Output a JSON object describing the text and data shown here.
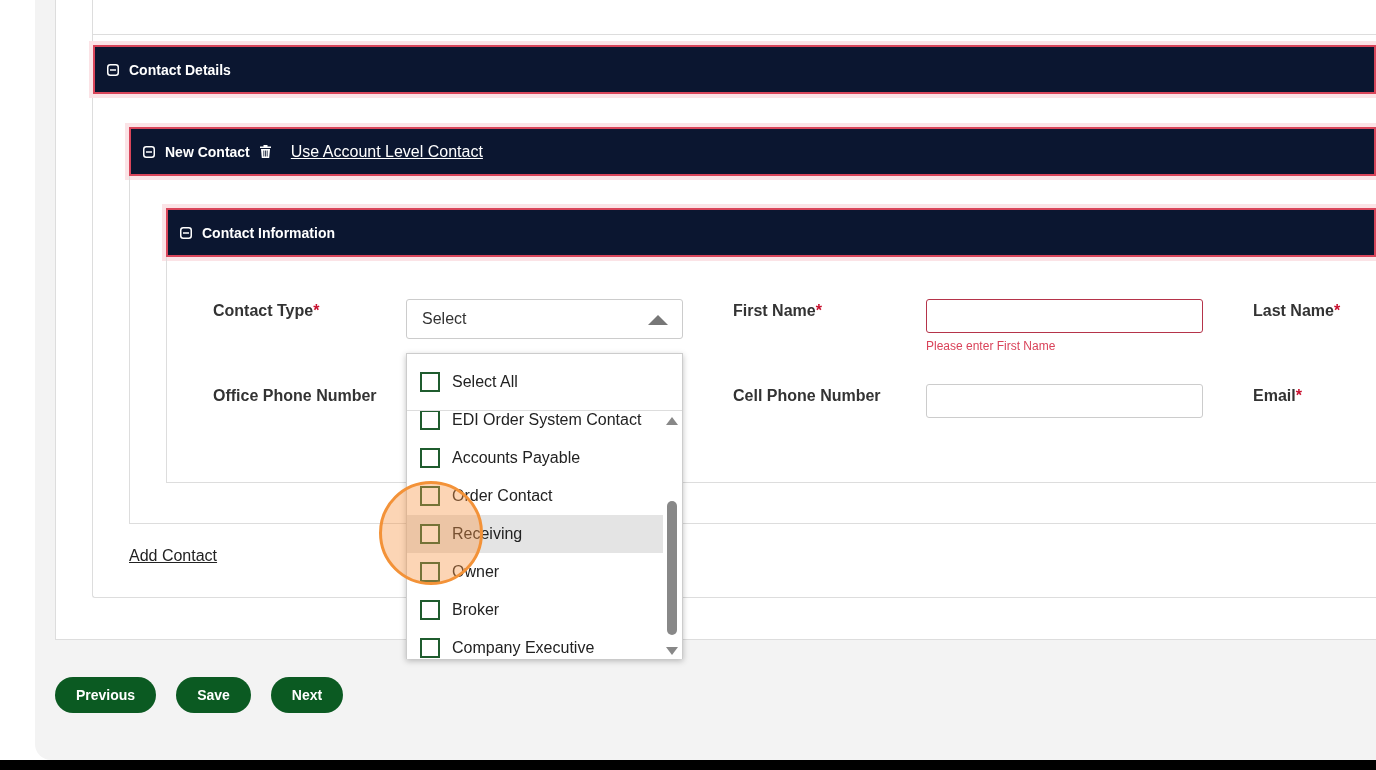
{
  "sections": {
    "contact_details": {
      "title": "Contact Details",
      "expanded": true
    },
    "new_contact": {
      "title": "New Contact",
      "link": "Use Account Level Contact",
      "expanded": true
    },
    "contact_information": {
      "title": "Contact Information",
      "expanded": true
    }
  },
  "fields": [
    {
      "label": "Contact Type",
      "required_mark": "*",
      "kind": "select",
      "value": "Select",
      "open": true
    },
    {
      "label": "First Name",
      "required_mark": "*",
      "kind": "text",
      "error": "Please enter First Name"
    },
    {
      "label": "Last Name",
      "required_mark": "*",
      "kind": "label_only"
    },
    {
      "label": "Office Phone Number",
      "kind": "label_only"
    },
    {
      "label": "Cell Phone Number",
      "kind": "text"
    },
    {
      "label": "Email",
      "required_mark": "*",
      "kind": "label_only"
    }
  ],
  "dropdown": {
    "select_all": {
      "label": "Select All",
      "checked": false
    },
    "options": [
      {
        "label": "EDI Order System Contact",
        "checked": false,
        "hovered": false
      },
      {
        "label": "Accounts Payable",
        "checked": false,
        "hovered": false
      },
      {
        "label": "Order Contact",
        "checked": false,
        "hovered": false
      },
      {
        "label": "Receiving",
        "checked": false,
        "hovered": true
      },
      {
        "label": "Owner",
        "checked": false,
        "hovered": false
      },
      {
        "label": "Broker",
        "checked": false,
        "hovered": false
      },
      {
        "label": "Company Executive",
        "checked": false,
        "hovered": false
      }
    ]
  },
  "add_contact": "Add Contact",
  "buttons": [
    "Previous",
    "Save",
    "Next"
  ]
}
